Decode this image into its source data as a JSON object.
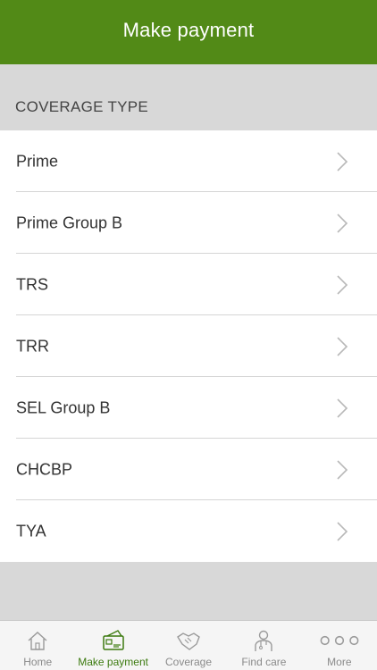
{
  "header": {
    "title": "Make payment"
  },
  "section": {
    "label": "COVERAGE TYPE"
  },
  "coverage_items": [
    {
      "label": "Prime"
    },
    {
      "label": "Prime Group B"
    },
    {
      "label": "TRS"
    },
    {
      "label": "TRR"
    },
    {
      "label": "SEL Group B"
    },
    {
      "label": "CHCBP"
    },
    {
      "label": "TYA"
    }
  ],
  "tabs": [
    {
      "label": "Home",
      "icon": "home-icon",
      "active": false
    },
    {
      "label": "Make payment",
      "icon": "payment-wallet-icon",
      "active": true
    },
    {
      "label": "Coverage",
      "icon": "handshake-icon",
      "active": false
    },
    {
      "label": "Find care",
      "icon": "doctor-icon",
      "active": false
    },
    {
      "label": "More",
      "icon": "more-dots-icon",
      "active": false
    }
  ],
  "colors": {
    "header_bg": "#528a17",
    "active_tab": "#3c7a0f",
    "inactive_tab": "#8a8a8a",
    "section_bg": "#d8d8d8"
  }
}
